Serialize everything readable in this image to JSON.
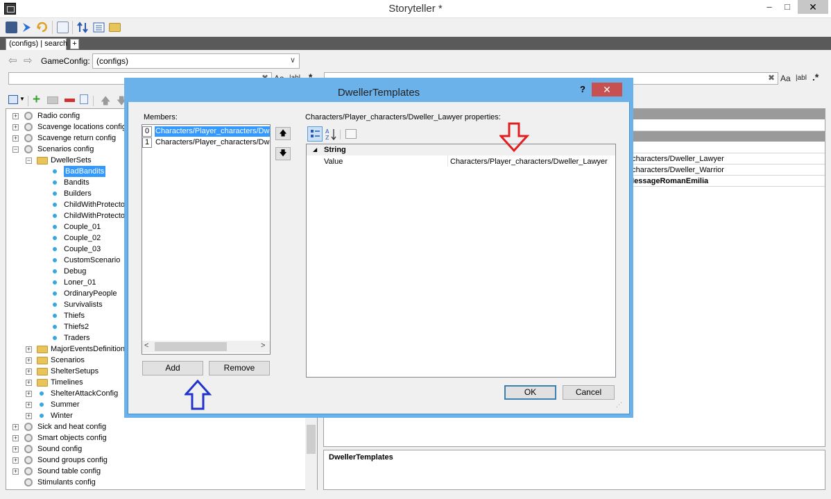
{
  "window": {
    "title": "Storyteller *",
    "min": "‒",
    "max": "□",
    "close": "✕"
  },
  "tabs": {
    "active": "(configs) | search",
    "add": "+"
  },
  "nav": {
    "back": "⇦",
    "forward": "⇨",
    "game_config_label": "GameConfig:",
    "game_config_value": "(configs)"
  },
  "search": {
    "left_value": "",
    "right_value": "",
    "clear": "✖",
    "case": "Aa",
    "word": "|abl",
    "regex": ".*"
  },
  "tree": [
    {
      "label": "Radio config",
      "level": 0,
      "icon": "gear",
      "expander": "+"
    },
    {
      "label": "Scavenge locations config",
      "level": 0,
      "icon": "gear",
      "expander": "+"
    },
    {
      "label": "Scavenge return config",
      "level": 0,
      "icon": "gear",
      "expander": "+"
    },
    {
      "label": "Scenarios config",
      "level": 0,
      "icon": "gear",
      "expander": "−"
    },
    {
      "label": "DwellerSets",
      "level": 1,
      "icon": "folder",
      "expander": "−"
    },
    {
      "label": "BadBandits",
      "level": 2,
      "icon": "dot",
      "selected": true
    },
    {
      "label": "Bandits",
      "level": 2,
      "icon": "dot"
    },
    {
      "label": "Builders",
      "level": 2,
      "icon": "dot"
    },
    {
      "label": "ChildWithProtector_",
      "level": 2,
      "icon": "dot"
    },
    {
      "label": "ChildWithProtector_",
      "level": 2,
      "icon": "dot"
    },
    {
      "label": "Couple_01",
      "level": 2,
      "icon": "dot"
    },
    {
      "label": "Couple_02",
      "level": 2,
      "icon": "dot"
    },
    {
      "label": "Couple_03",
      "level": 2,
      "icon": "dot"
    },
    {
      "label": "CustomScenario",
      "level": 2,
      "icon": "dot"
    },
    {
      "label": "Debug",
      "level": 2,
      "icon": "dot"
    },
    {
      "label": "Loner_01",
      "level": 2,
      "icon": "dot"
    },
    {
      "label": "OrdinaryPeople",
      "level": 2,
      "icon": "dot"
    },
    {
      "label": "Survivalists",
      "level": 2,
      "icon": "dot"
    },
    {
      "label": "Thiefs",
      "level": 2,
      "icon": "dot"
    },
    {
      "label": "Thiefs2",
      "level": 2,
      "icon": "dot"
    },
    {
      "label": "Traders",
      "level": 2,
      "icon": "dot"
    },
    {
      "label": "MajorEventsDefinitions",
      "level": 1,
      "icon": "folder",
      "expander": "+"
    },
    {
      "label": "Scenarios",
      "level": 1,
      "icon": "folder",
      "expander": "+"
    },
    {
      "label": "ShelterSetups",
      "level": 1,
      "icon": "folder",
      "expander": "+"
    },
    {
      "label": "Timelines",
      "level": 1,
      "icon": "folder",
      "expander": "+"
    },
    {
      "label": "ShelterAttackConfig",
      "level": 1,
      "icon": "dot",
      "expander": "+"
    },
    {
      "label": "Summer",
      "level": 1,
      "icon": "dot",
      "expander": "+"
    },
    {
      "label": "Winter",
      "level": 1,
      "icon": "dot",
      "expander": "+"
    },
    {
      "label": "Sick and heat config",
      "level": 0,
      "icon": "gear",
      "expander": "+"
    },
    {
      "label": "Smart objects config",
      "level": 0,
      "icon": "gear",
      "expander": "+"
    },
    {
      "label": "Sound config",
      "level": 0,
      "icon": "gear",
      "expander": "+"
    },
    {
      "label": "Sound groups config",
      "level": 0,
      "icon": "gear",
      "expander": "+"
    },
    {
      "label": "Sound table config",
      "level": 0,
      "icon": "gear",
      "expander": "+"
    },
    {
      "label": "Stimulants config",
      "level": 0,
      "icon": "gear",
      "expander": ""
    }
  ],
  "right_panel": {
    "rows": [
      "_characters/Dweller_Lawyer",
      "_characters/Dweller_Warrior",
      "MessageRomanEmilia"
    ],
    "description_title": "DwellerTemplates"
  },
  "dialog": {
    "title": "DwellerTemplates",
    "help": "?",
    "close": "✕",
    "members_label": "Members:",
    "members": [
      {
        "index": "0",
        "text": "Characters/Player_characters/Dweller_Lawyer",
        "selected": true
      },
      {
        "index": "1",
        "text": "Characters/Player_characters/Dweller_Warrior",
        "selected": false
      }
    ],
    "move_up": "🡅",
    "move_down": "🡇",
    "add_label": "Add",
    "remove_label": "Remove",
    "properties_label": "Characters/Player_characters/Dweller_Lawyer properties:",
    "category": "String",
    "property_name": "Value",
    "property_value": "Characters/Player_characters/Dweller_Lawyer",
    "ok_label": "OK",
    "cancel_label": "Cancel"
  },
  "colors": {
    "selection": "#3399ff",
    "dialog_frame": "#6bb1ea",
    "close_button": "#c75050",
    "annotation_red": "#e02020",
    "annotation_blue": "#2233cc"
  }
}
